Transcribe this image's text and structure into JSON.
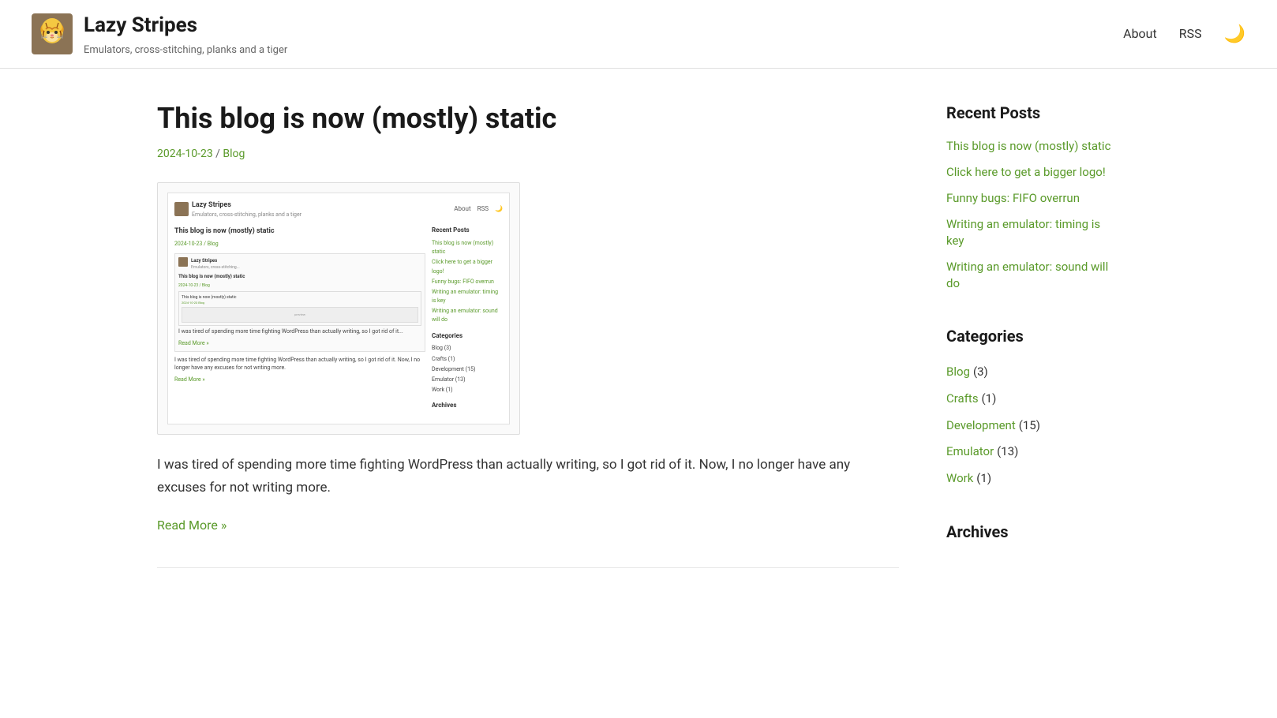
{
  "site": {
    "title": "Lazy Stripes",
    "tagline": "Emulators, cross-stitching, planks and a tiger",
    "logo_alt": "Lazy Stripes logo"
  },
  "header": {
    "nav": {
      "about_label": "About",
      "rss_label": "RSS",
      "darkmode_label": "🌙"
    }
  },
  "main_post": {
    "title": "This blog is now (mostly) static",
    "date": "2024-10-23",
    "category": "Blog",
    "body": "I was tired of spending more time fighting WordPress than actually writing, so I got rid of it. Now, I no longer have any excuses for not writing more.",
    "read_more": "Read More »"
  },
  "sidebar": {
    "recent_posts_heading": "Recent Posts",
    "posts": [
      "This blog is now (mostly) static",
      "Click here to get a bigger logo!",
      "Funny bugs: FIFO overrun",
      "Writing an emulator: timing is key",
      "Writing an emulator: sound will do"
    ],
    "categories_heading": "Categories",
    "categories": [
      {
        "name": "Blog",
        "count": 3
      },
      {
        "name": "Crafts",
        "count": 1
      },
      {
        "name": "Development",
        "count": 15
      },
      {
        "name": "Emulator",
        "count": 13
      },
      {
        "name": "Work",
        "count": 1
      }
    ],
    "archives_heading": "Archives"
  },
  "screenshot_preview": {
    "post_title": "This blog is now (mostly) static",
    "meta": "2024-10-23 / Blog",
    "text1": "I was tired of spending more time fighting WordPress than actually writing, so I got rid of it. Now, I no longer have any excuses for not writing more.",
    "readmore": "Read More »",
    "sidebar_title": "Recent Posts",
    "sidebar_links": [
      "This blog is now (mostly) static",
      "Click here to get a bigger logo!",
      "Funny bugs: FIFO overrun",
      "Writing an emulator: timing is key",
      "Writing an emulator: sound will do"
    ],
    "categories_title": "Categories",
    "categories": [
      "Blog (3)",
      "Crafts (1)",
      "Development (15)",
      "Emulator (13)",
      "Work (1)"
    ]
  }
}
